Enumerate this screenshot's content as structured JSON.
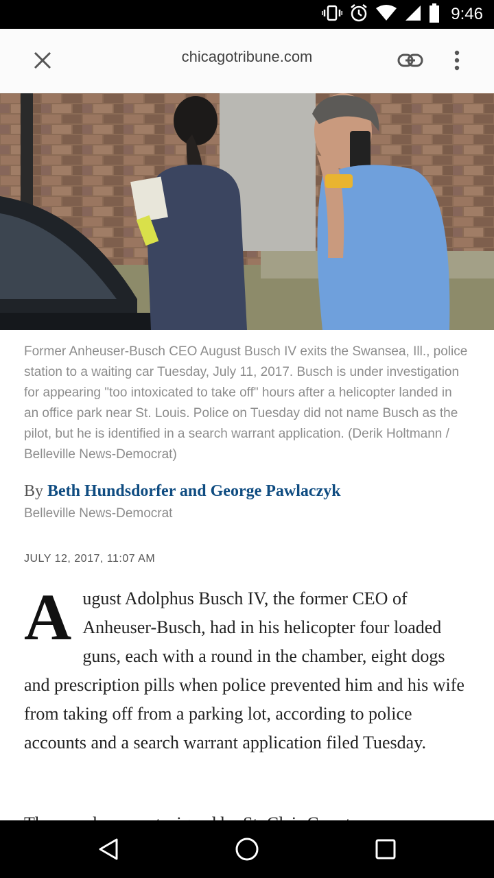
{
  "status_bar": {
    "time": "9:46",
    "icons": [
      "vibrate-icon",
      "alarm-icon",
      "wifi-icon",
      "signal-icon",
      "battery-icon"
    ]
  },
  "toolbar": {
    "domain": "chicagotribune.com",
    "icons": [
      "close-icon",
      "link-icon",
      "more-vert-icon"
    ]
  },
  "article": {
    "caption": "Former Anheuser-Busch CEO August Busch IV exits the Swansea, Ill., police station to a waiting car Tuesday, July 11, 2017. Busch is under investigation for appearing \"too intoxicated to take off\" hours after a helicopter landed in an office park near St. Louis. Police on Tuesday did not name Busch as the pilot, but he is identified in a search warrant application. (Derik Holtmann / Belleville News-Democrat)",
    "by_prefix": "By",
    "authors": "Beth Hundsdorfer and George Pawlaczyk",
    "source": "Belleville News-Democrat",
    "dateline": "JULY 12, 2017, 11:07 AM",
    "drop_cap": "A",
    "first_paragraph": "ugust Adolphus Busch IV, the former CEO of Anheuser-Busch, had in his helicopter four loaded guns, each with a round in the chamber, eight dogs and prescription pills when police prevented him and his wife from taking off from a parking lot, according to police accounts and a search warrant application filed Tuesday.",
    "next_paragraph_partial": "The search warrant, signed by St. Clair County"
  },
  "nav_bar": {
    "icons": [
      "back-icon",
      "home-icon",
      "recents-icon"
    ]
  },
  "colors": {
    "author_link": "#0f4c81",
    "caption_text": "#8c8c8c",
    "toolbar_bg": "#fbfbfb"
  }
}
